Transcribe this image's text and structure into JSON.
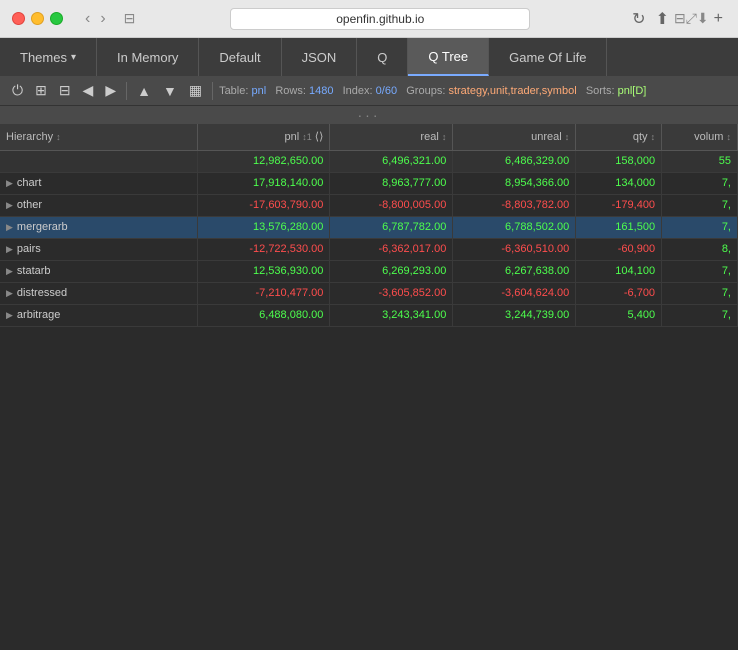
{
  "titlebar": {
    "url": "openfin.github.io",
    "traffic_lights": [
      "red",
      "yellow",
      "green"
    ]
  },
  "nav": {
    "tabs": [
      {
        "id": "themes",
        "label": "Themes",
        "has_arrow": true,
        "active": false
      },
      {
        "id": "in-memory",
        "label": "In Memory",
        "active": false
      },
      {
        "id": "default",
        "label": "Default",
        "active": false
      },
      {
        "id": "json",
        "label": "JSON",
        "active": false
      },
      {
        "id": "q",
        "label": "Q",
        "active": false
      },
      {
        "id": "q-tree",
        "label": "Q Tree",
        "active": true
      },
      {
        "id": "game-of-life",
        "label": "Game Of Life",
        "active": false
      }
    ]
  },
  "toolbar": {
    "table_label": "Table:",
    "table_name": "pnl",
    "rows_label": "Rows:",
    "rows_value": "1480",
    "index_label": "Index:",
    "index_value": "0/60",
    "groups_label": "Groups:",
    "groups_value": "strategy,unit,trader,symbol",
    "sorts_label": "Sorts:",
    "sorts_value": "pnl[D]"
  },
  "table": {
    "columns": [
      {
        "id": "hierarchy",
        "label": "Hierarchy",
        "sortable": true
      },
      {
        "id": "pnl",
        "label": "pnl",
        "sort_dir": "↕1",
        "sortable": true
      },
      {
        "id": "real",
        "label": "real",
        "sortable": true
      },
      {
        "id": "unreal",
        "label": "unreal",
        "sortable": true
      },
      {
        "id": "qty",
        "label": "qty",
        "sortable": true
      },
      {
        "id": "volume",
        "label": "volum",
        "sortable": true
      }
    ],
    "summary_row": {
      "hierarchy": "",
      "pnl": "12,982,650.00",
      "real": "6,496,321.00",
      "unreal": "6,486,329.00",
      "qty": "158,000",
      "volume": "55"
    },
    "rows": [
      {
        "id": "chart",
        "hierarchy": "chart",
        "expandable": true,
        "expanded": false,
        "pnl": "17,918,140.00",
        "pnl_class": "positive",
        "real": "8,963,777.00",
        "real_class": "positive",
        "unreal": "8,954,366.00",
        "unreal_class": "positive",
        "qty": "134,000",
        "qty_class": "positive",
        "volume": "7,",
        "volume_class": "positive"
      },
      {
        "id": "other",
        "hierarchy": "other",
        "expandable": true,
        "expanded": false,
        "pnl": "-17,603,790.00",
        "pnl_class": "negative",
        "real": "-8,800,005.00",
        "real_class": "negative",
        "unreal": "-8,803,782.00",
        "unreal_class": "negative",
        "qty": "-179,400",
        "qty_class": "negative",
        "volume": "7,",
        "volume_class": "positive"
      },
      {
        "id": "mergerarb",
        "hierarchy": "mergerarb",
        "expandable": true,
        "expanded": false,
        "selected": true,
        "pnl": "13,576,280.00",
        "pnl_class": "positive",
        "real": "6,787,782.00",
        "real_class": "positive",
        "unreal": "6,788,502.00",
        "unreal_class": "positive",
        "qty": "161,500",
        "qty_class": "positive",
        "volume": "7,",
        "volume_class": "positive"
      },
      {
        "id": "pairs",
        "hierarchy": "pairs",
        "expandable": true,
        "expanded": false,
        "pnl": "-12,722,530.00",
        "pnl_class": "negative",
        "real": "-6,362,017.00",
        "real_class": "negative",
        "unreal": "-6,360,510.00",
        "unreal_class": "negative",
        "qty": "-60,900",
        "qty_class": "negative",
        "volume": "8,",
        "volume_class": "positive"
      },
      {
        "id": "statarb",
        "hierarchy": "statarb",
        "expandable": true,
        "expanded": false,
        "pnl": "12,536,930.00",
        "pnl_class": "positive",
        "real": "6,269,293.00",
        "real_class": "positive",
        "unreal": "6,267,638.00",
        "unreal_class": "positive",
        "qty": "104,100",
        "qty_class": "positive",
        "volume": "7,",
        "volume_class": "positive"
      },
      {
        "id": "distressed",
        "hierarchy": "distressed",
        "expandable": true,
        "expanded": false,
        "pnl": "-7,210,477.00",
        "pnl_class": "negative",
        "real": "-3,605,852.00",
        "real_class": "negative",
        "unreal": "-3,604,624.00",
        "unreal_class": "negative",
        "qty": "-6,700",
        "qty_class": "negative",
        "volume": "7,",
        "volume_class": "positive"
      },
      {
        "id": "arbitrage",
        "hierarchy": "arbitrage",
        "expandable": true,
        "expanded": false,
        "pnl": "6,488,080.00",
        "pnl_class": "positive",
        "real": "3,243,341.00",
        "real_class": "positive",
        "unreal": "3,244,739.00",
        "unreal_class": "positive",
        "qty": "5,400",
        "qty_class": "positive",
        "volume": "7,",
        "volume_class": "positive"
      }
    ]
  },
  "icons": {
    "expand": "▶",
    "collapse": "▼",
    "back": "‹",
    "forward": "›",
    "refresh": "↻",
    "share": "⬆",
    "plus": "+",
    "window": "⊟",
    "minimize": "—",
    "maximize": "⤢",
    "download": "⬇",
    "power": "⏻",
    "sort_asc": "↑",
    "sort_desc": "↓",
    "col_sort": "↕",
    "dots": "···"
  }
}
